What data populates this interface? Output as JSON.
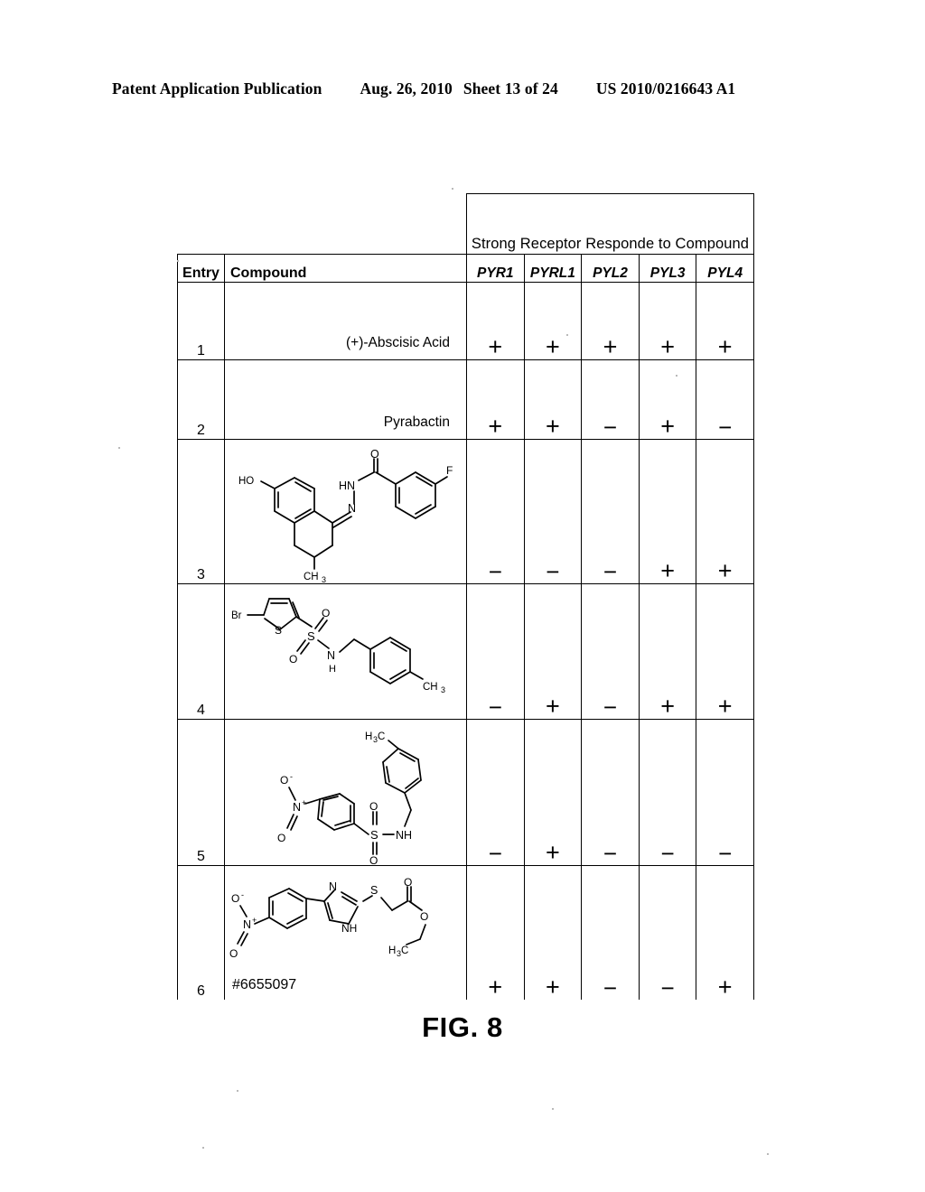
{
  "page_header": {
    "publication": "Patent Application Publication",
    "date": "Aug. 26, 2010",
    "sheet": "Sheet 13 of 24",
    "patent_number": "US 2010/0216643 A1"
  },
  "figure": {
    "caption": "FIG. 8"
  },
  "table": {
    "group_header": "Strong Receptor Responde to Compound",
    "columns": {
      "entry": "Entry",
      "compound": "Compound",
      "receptors": [
        "PYR1",
        "PYRL1",
        "PYL2",
        "PYL3",
        "PYL4"
      ]
    },
    "rows": [
      {
        "entry": "1",
        "compound_name": "(+)-Abscisic Acid",
        "structure": "none",
        "responses": [
          "+",
          "+",
          "+",
          "+",
          "+"
        ]
      },
      {
        "entry": "2",
        "compound_name": "Pyrabactin",
        "structure": "none",
        "responses": [
          "+",
          "+",
          "−",
          "+",
          "−"
        ]
      },
      {
        "entry": "3",
        "compound_name": "",
        "structure": "hydroxy-methyl-tetralinylidene-hydrazide-fluorobenzamide",
        "structure_labels": [
          "HO",
          "O",
          "HN",
          "N",
          "F",
          "CH3"
        ],
        "responses": [
          "−",
          "−",
          "−",
          "+",
          "+"
        ]
      },
      {
        "entry": "4",
        "compound_name": "",
        "structure": "bromothiophene-sulfonamide-methylbenzyl",
        "structure_labels": [
          "Br",
          "S",
          "O",
          "O",
          "S",
          "N",
          "H",
          "CH3"
        ],
        "responses": [
          "−",
          "+",
          "−",
          "+",
          "+"
        ]
      },
      {
        "entry": "5",
        "compound_name": "",
        "structure": "nitrobenzene-sulfonamide-methylbenzyl",
        "structure_labels": [
          "H3C",
          "O-",
          "N+",
          "O",
          "O",
          "S",
          "O",
          "NH"
        ],
        "responses": [
          "−",
          "+",
          "−",
          "−",
          "−"
        ]
      },
      {
        "entry": "6",
        "compound_name": "#6655097",
        "structure": "nitrophenyl-imidazole-thio-ethyl-acetate",
        "structure_labels": [
          "O-",
          "N+",
          "O",
          "N",
          "NH",
          "S",
          "O",
          "O",
          "H3C"
        ],
        "responses": [
          "+",
          "+",
          "−",
          "−",
          "+"
        ]
      }
    ]
  }
}
